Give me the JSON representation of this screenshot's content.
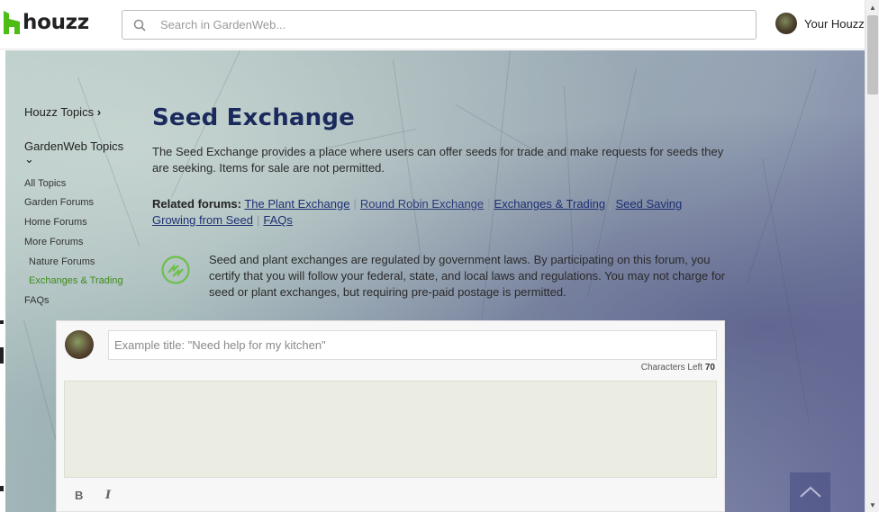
{
  "header": {
    "logo_text": "houzz",
    "search_placeholder": "Search in GardenWeb...",
    "user_label": "Your Houzz"
  },
  "sidebar": {
    "houzz_topics": "Houzz Topics",
    "houzz_topics_chevron": "›",
    "gardenweb_topics": "GardenWeb Topics",
    "gardenweb_topics_chevron": "⌄",
    "links": [
      {
        "label": "All Topics",
        "active": false
      },
      {
        "label": "Garden Forums",
        "active": false
      },
      {
        "label": "Home Forums",
        "active": false
      },
      {
        "label": "More Forums",
        "active": false
      },
      {
        "label": "Nature Forums",
        "active": false
      },
      {
        "label": "Exchanges & Trading",
        "active": true
      },
      {
        "label": "FAQs",
        "active": false
      }
    ]
  },
  "main": {
    "title": "Seed Exchange",
    "description": "The Seed Exchange provides a place where users can offer seeds for trade and make requests for seeds they are seeking. Items for sale are not permitted.",
    "related_label": "Related forums:",
    "related_links": [
      "The Plant Exchange",
      "Round Robin Exchange",
      "Exchanges & Trading",
      "Seed Saving",
      "Growing from Seed",
      "FAQs"
    ],
    "notice": "Seed and plant exchanges are regulated by government laws. By participating on this forum, you certify that you will follow your federal, state, and local laws and regulations. You may not charge for seed or plant exchanges, but requiring pre-paid postage is permitted."
  },
  "compose": {
    "title_placeholder": "Example title: \"Need help for my kitchen\"",
    "chars_left_label": "Characters Left",
    "chars_left_value": "70",
    "bold_label": "B",
    "italic_label": "I"
  },
  "colors": {
    "title": "#1b2a5c",
    "link": "#1e2f73",
    "active_link": "#3f8a1e",
    "brand_green": "#4dbc15"
  },
  "icons": [
    "houzz-logo-icon",
    "search-icon",
    "exchange-icon",
    "back-to-top-icon"
  ]
}
